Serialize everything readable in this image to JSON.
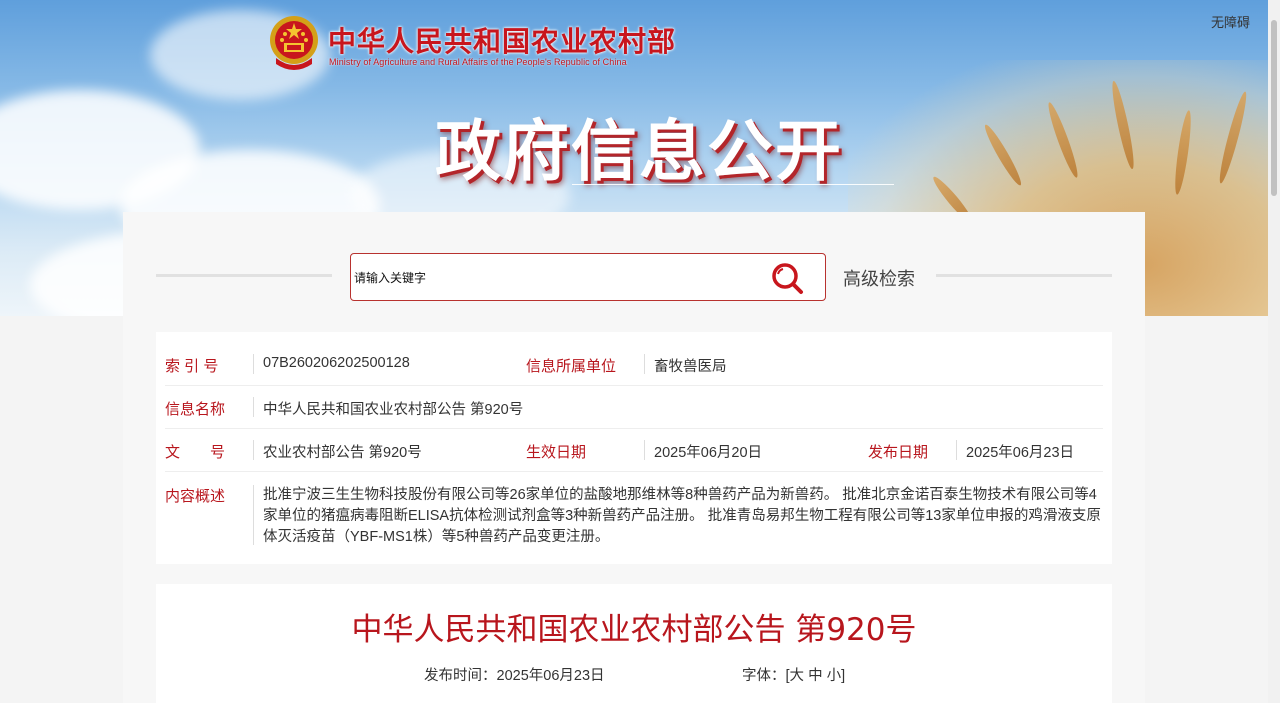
{
  "header": {
    "ministry_cn": "中华人民共和国农业农村部",
    "ministry_en": "Ministry of Agriculture and Rural Affairs of the People's Republic of China",
    "accessibility": "无障碍",
    "banner_title": "政府信息公开"
  },
  "search": {
    "placeholder": "请输入关键字",
    "advanced_label": "高级检索"
  },
  "info": {
    "index_label": "索 引 号",
    "index_value": "07B260206202500128",
    "unit_label": "信息所属单位",
    "unit_value": "畜牧兽医局",
    "name_label": "信息名称",
    "name_value": "中华人民共和国农业农村部公告 第920号",
    "doc_label": "文　　号",
    "doc_value": "农业农村部公告 第920号",
    "effective_label": "生效日期",
    "effective_value": "2025年06月20日",
    "publish_label": "发布日期",
    "publish_value": "2025年06月23日",
    "summary_label": "内容概述",
    "summary_value": "批准宁波三生生物科技股份有限公司等26家单位的盐酸地那维林等8种兽药产品为新兽药。 批准北京金诺百泰生物技术有限公司等4家单位的猪瘟病毒阻断ELISA抗体检测试剂盒等3种新兽药产品注册。 批准青岛易邦生物工程有限公司等13家单位申报的鸡滑液支原体灭活疫苗（YBF-MS1株）等5种兽药产品变更注册。"
  },
  "article": {
    "title": "中华人民共和国农业农村部公告 第920号",
    "publish_label": "发布时间：",
    "publish_date": "2025年06月23日",
    "font_label": "字体：",
    "font_open": "[",
    "font_large": "大",
    "font_medium": "中",
    "font_small": "小",
    "font_close": "]"
  },
  "colors": {
    "accent": "#b8161d",
    "border": "#b8322f",
    "panel": "#f7f7f7"
  },
  "icons": {
    "emblem": "national-emblem-icon",
    "search": "search-icon"
  }
}
